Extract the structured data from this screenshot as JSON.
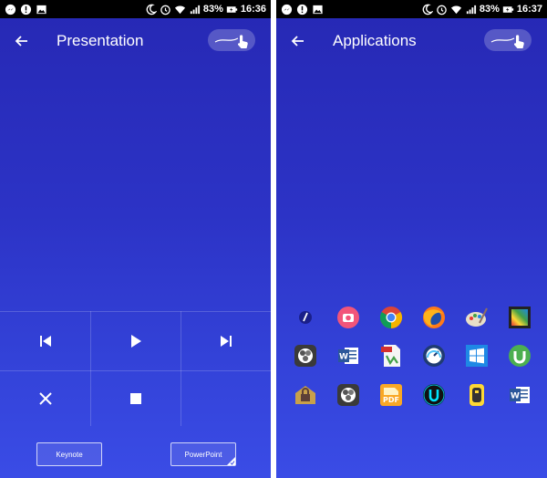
{
  "status_left": {
    "battery_pct": "83%",
    "time": "16:36"
  },
  "status_right": {
    "battery_pct": "83%",
    "time": "16:37"
  },
  "presentation": {
    "title": "Presentation",
    "controls": [
      "previous-icon",
      "play-icon",
      "next-icon",
      "close-icon",
      "stop-icon",
      ""
    ],
    "buttons": {
      "keynote": "Keynote",
      "powerpoint": "PowerPoint",
      "selected": "PowerPoint"
    }
  },
  "applications": {
    "title": "Applications",
    "apps": [
      [
        "zoom-icon",
        "camera-icon",
        "chrome-icon",
        "firefox-icon",
        "paint-icon",
        "film-icon"
      ],
      [
        "aperture-icon",
        "word-icon",
        "pdf-doc-icon",
        "speed-icon",
        "windows-icon",
        "utorrent-icon"
      ],
      [
        "lock-icon",
        "aperture-icon",
        "pdf-icon",
        "u-icon",
        "usb-icon",
        "word-icon"
      ]
    ]
  },
  "colors": {
    "background_top": "#2628b4",
    "background_bottom": "#3a4ce6",
    "statusbar": "#000000"
  }
}
